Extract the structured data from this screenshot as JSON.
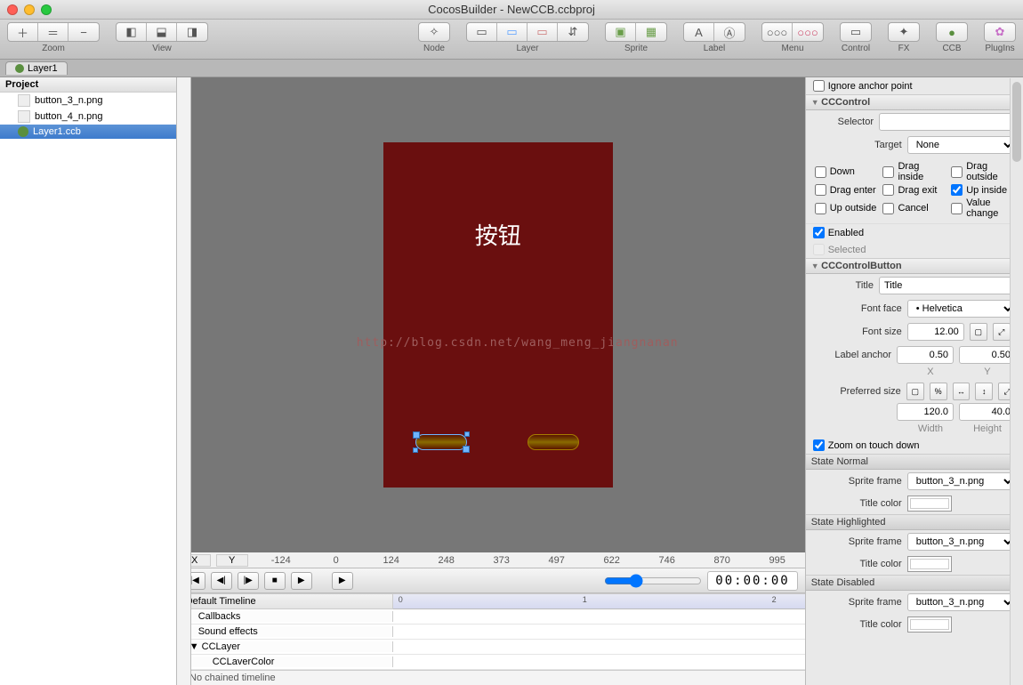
{
  "window": {
    "title": "CocosBuilder - NewCCB.ccbproj"
  },
  "toolbar": {
    "zoom": "Zoom",
    "view": "View",
    "node": "Node",
    "layer": "Layer",
    "sprite": "Sprite",
    "label": "Label",
    "menu": "Menu",
    "control": "Control",
    "fx": "FX",
    "ccb": "CCB",
    "plugins": "PlugIns"
  },
  "tab": {
    "label": "Layer1"
  },
  "project": {
    "title": "Project",
    "items": [
      {
        "name": "button_3_n.png",
        "type": "img"
      },
      {
        "name": "button_4_n.png",
        "type": "img"
      },
      {
        "name": "Layer1.ccb",
        "type": "ccb",
        "selected": true
      }
    ]
  },
  "canvas": {
    "button_text": "按钮",
    "watermark": "http://blog.csdn.net/wang_meng_jiangnanan",
    "ruler_x": [
      "-124",
      "0",
      "124",
      "248",
      "373",
      "497",
      "622",
      "746",
      "870",
      "995"
    ],
    "x_label": "X",
    "y_label": "Y"
  },
  "timeline": {
    "default": "Default Timeline",
    "rows": [
      "Callbacks",
      "Sound effects",
      "CCLayer",
      "CCLaverColor"
    ],
    "footer": "No chained timeline",
    "timecode": "00:00:00",
    "ticks": [
      "0",
      "1",
      "2"
    ]
  },
  "inspector": {
    "ignore_anchor": "Ignore anchor point",
    "sec_cccontrol": "CCControl",
    "selector": "Selector",
    "target": "Target",
    "target_val": "None",
    "evt": {
      "down": "Down",
      "dragInside": "Drag inside",
      "dragOutside": "Drag outside",
      "dragEnter": "Drag enter",
      "dragExit": "Drag exit",
      "upInside": "Up inside",
      "upOutside": "Up outside",
      "cancel": "Cancel",
      "valueChange": "Value change"
    },
    "enabled": "Enabled",
    "selected": "Selected",
    "sec_ccbutton": "CCControlButton",
    "title": "Title",
    "title_val": "Title",
    "fontface": "Font face",
    "fontface_val": "• Helvetica",
    "fontsize": "Font size",
    "fontsize_val": "12.00",
    "labelanchor": "Label anchor",
    "ax": "0.50",
    "ay": "0.50",
    "xl": "X",
    "yl": "Y",
    "prefsize": "Preferred size",
    "pw": "120.0",
    "ph": "40.0",
    "wl": "Width",
    "hl": "Height",
    "zoomtouch": "Zoom on touch down",
    "state_normal": "State Normal",
    "state_high": "State Highlighted",
    "state_dis": "State Disabled",
    "spriteframe": "Sprite frame",
    "spriteframe_val": "button_3_n.png",
    "titlecolor": "Title color",
    "pct": "%"
  }
}
